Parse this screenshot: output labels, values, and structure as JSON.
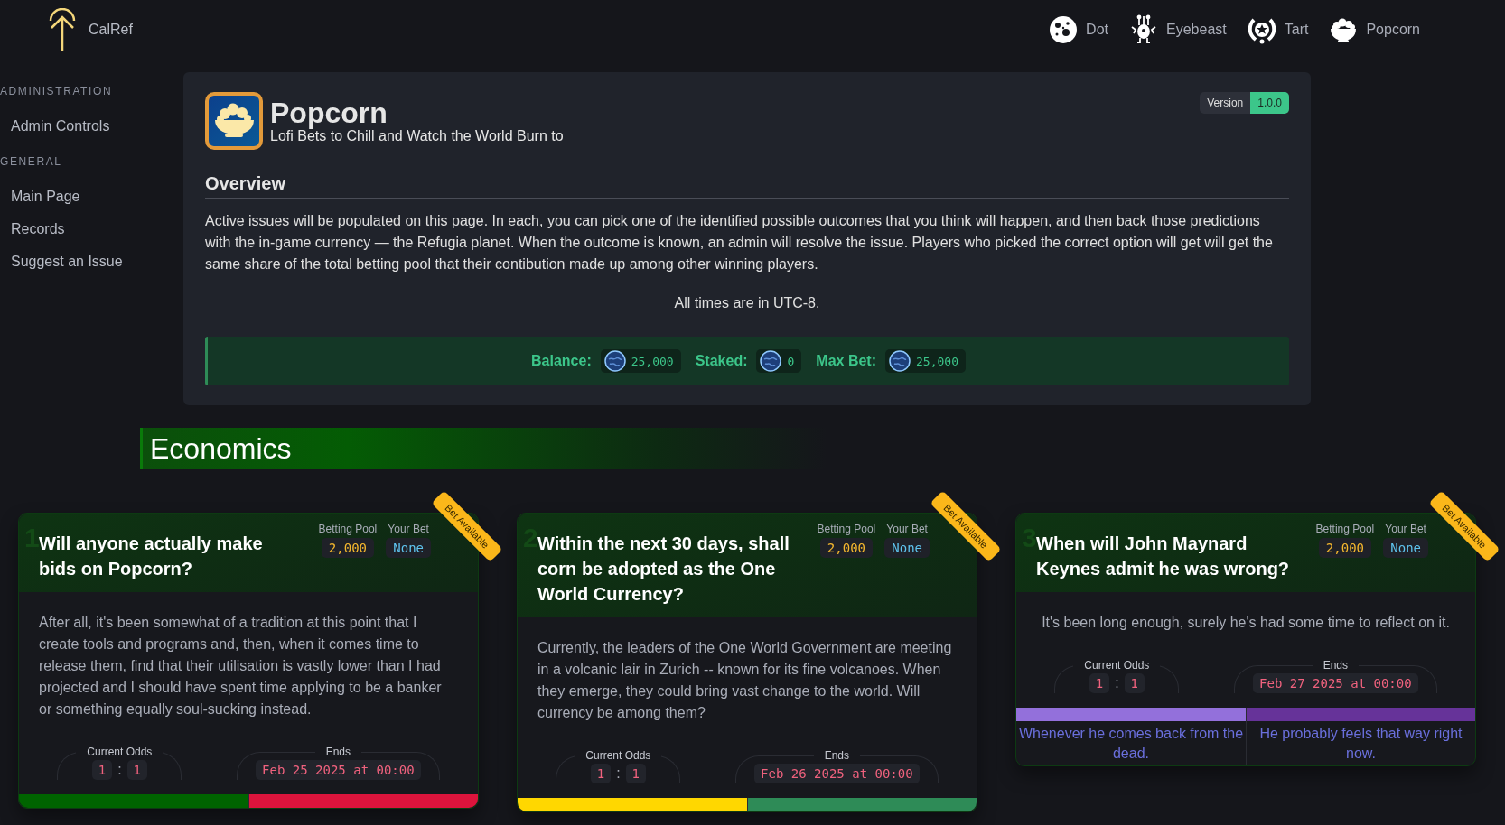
{
  "brand": {
    "name": "CalRef"
  },
  "top_nav": [
    {
      "label": "Dot",
      "kind": "planet"
    },
    {
      "label": "Eyebeast",
      "kind": "creature"
    },
    {
      "label": "Tart",
      "kind": "wreath"
    },
    {
      "label": "Popcorn",
      "kind": "bowl"
    }
  ],
  "sidebar": {
    "sections": [
      {
        "heading": "ADMINISTRATION",
        "items": [
          {
            "label": "Admin Controls"
          }
        ]
      },
      {
        "heading": "GENERAL",
        "items": [
          {
            "label": "Main Page"
          },
          {
            "label": "Records"
          },
          {
            "label": "Suggest an Issue"
          }
        ]
      }
    ]
  },
  "app": {
    "title": "Popcorn",
    "subtitle": "Lofi Bets to Chill and Watch the World Burn to",
    "version_label": "Version",
    "version": "1.0.0",
    "overview_heading": "Overview",
    "overview_text": "Active issues will be populated on this page. In each, you can pick one of the identified possible outcomes that you think will happen, and then back those predictions with the in-game currency — the Refugia planet. When the outcome is known, an admin will resolve the issue. Players who picked the correct option will get will get the same share of the total betting pool that their contibution made up among other winning players.",
    "timezone_note": "All times are in UTC-8.",
    "stats": [
      {
        "label": "Balance:",
        "value": "25,000"
      },
      {
        "label": "Staked:",
        "value": "0"
      },
      {
        "label": "Max Bet:",
        "value": "25,000"
      }
    ]
  },
  "category": {
    "title": "Economics"
  },
  "issues": [
    {
      "number": "1",
      "title": "Will anyone actually make bids on Popcorn?",
      "pool_label": "Betting Pool",
      "pool": "2,000",
      "bet_label": "Your Bet",
      "bet": "None",
      "ribbon": "Bet Available",
      "description": "After all, it's been somewhat of a tradition at this point that I create tools and programs and, then, when it comes time to release them, find that their utilisation is vastly lower than I had projected and I should have spent time applying to be a banker or something equally soul-sucking instead.",
      "odds_label": "Current Odds",
      "odds": [
        "1",
        "1"
      ],
      "odds_separator": ":",
      "ends_label": "Ends",
      "ends": "Feb 25 2025 at 00:00",
      "options": [
        {
          "color": "#006400"
        },
        {
          "color": "#dc143c"
        }
      ]
    },
    {
      "number": "2",
      "title": "Within the next 30 days, shall corn be adopted as the One World Currency?",
      "pool_label": "Betting Pool",
      "pool": "2,000",
      "bet_label": "Your Bet",
      "bet": "None",
      "ribbon": "Bet Available",
      "description": "Currently, the leaders of the One World Government are meeting in a volcanic lair in Zurich -- known for its fine volcanoes. When they emerge, they could bring vast change to the world. Will currency be among them?",
      "odds_label": "Current Odds",
      "odds": [
        "1",
        "1"
      ],
      "odds_separator": ":",
      "ends_label": "Ends",
      "ends": "Feb 26 2025 at 00:00",
      "options": [
        {
          "color": "#ffd700"
        },
        {
          "color": "#2e8b57"
        }
      ]
    },
    {
      "number": "3",
      "title": "When will John Maynard Keynes admit he was wrong?",
      "pool_label": "Betting Pool",
      "pool": "2,000",
      "bet_label": "Your Bet",
      "bet": "None",
      "ribbon": "Bet Available",
      "description": "It's been long enough, surely he's had some time to reflect on it.",
      "odds_label": "Current Odds",
      "odds": [
        "1",
        "1"
      ],
      "odds_separator": ":",
      "ends_label": "Ends",
      "ends": "Feb 27 2025 at 00:00",
      "options": [
        {
          "color": "#9370db",
          "label": "Whenever he comes back from the dead."
        },
        {
          "color": "#663399",
          "label": "He probably feels that way right now."
        }
      ]
    }
  ]
}
